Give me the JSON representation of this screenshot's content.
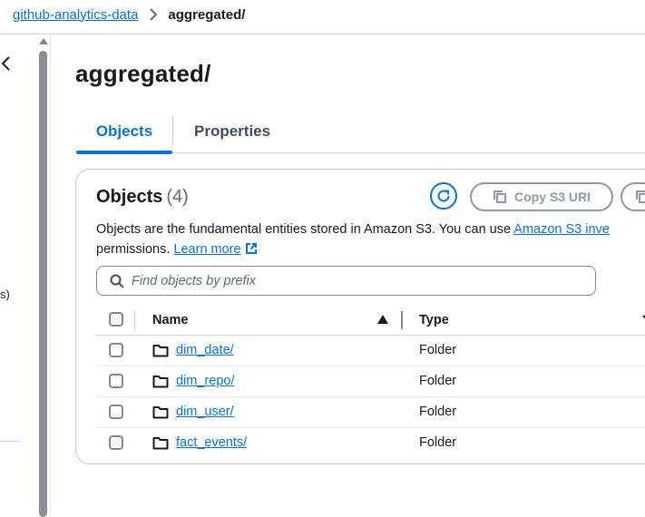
{
  "breadcrumb": {
    "bucket": "github-analytics-data",
    "current": "aggregated/"
  },
  "left_panel": {
    "fragment": "s)"
  },
  "page": {
    "title": "aggregated/"
  },
  "tabs": [
    {
      "label": "Objects",
      "active": true
    },
    {
      "label": "Properties",
      "active": false
    }
  ],
  "objects": {
    "heading": "Objects",
    "count": "(4)",
    "copy_button": "Copy S3 URI",
    "description_1": "Objects are the fundamental entities stored in Amazon S3. You can use ",
    "description_link": "Amazon S3 inve",
    "description_2": "permissions. ",
    "learn_more": "Learn more",
    "search_placeholder": "Find objects by prefix",
    "columns": {
      "name": "Name",
      "type": "Type"
    },
    "rows": [
      {
        "name": "dim_date/",
        "type": "Folder"
      },
      {
        "name": "dim_repo/",
        "type": "Folder"
      },
      {
        "name": "dim_user/",
        "type": "Folder"
      },
      {
        "name": "fact_events/",
        "type": "Folder"
      }
    ]
  },
  "colors": {
    "link": "#0972d3",
    "text": "#16191f",
    "border": "#c6c6cd"
  }
}
